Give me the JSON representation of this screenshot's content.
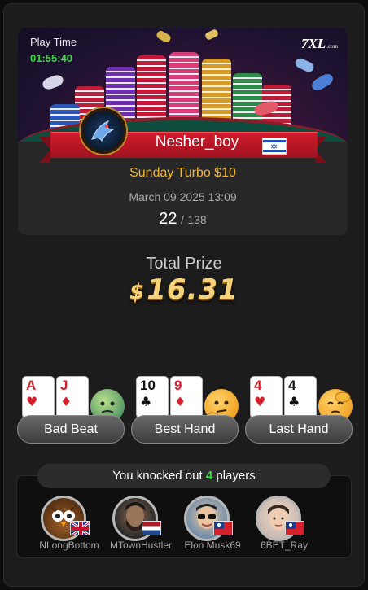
{
  "header": {
    "play_time_label": "Play Time",
    "play_time": "01:55:40",
    "logo_text": "7XL",
    "logo_suffix": ".com"
  },
  "player": {
    "name": "Nesher_boy",
    "flag": "israel-flag"
  },
  "tournament": {
    "name": "Sunday Turbo $10",
    "date": "March 09 2025 13:09",
    "position": "22",
    "separator": "/",
    "total_players": "138"
  },
  "prize": {
    "label": "Total Prize",
    "currency": "$",
    "amount": "16.31"
  },
  "hands": [
    {
      "label": "Bad Beat",
      "cards": [
        {
          "rank": "A",
          "suit": "♥",
          "color": "red"
        },
        {
          "rank": "J",
          "suit": "♦",
          "color": "red"
        }
      ],
      "emoji": "sick-face-icon"
    },
    {
      "label": "Best Hand",
      "cards": [
        {
          "rank": "10",
          "suit": "♣",
          "color": "black"
        },
        {
          "rank": "9",
          "suit": "♦",
          "color": "red"
        }
      ],
      "emoji": "thinking-face-icon"
    },
    {
      "label": "Last Hand",
      "cards": [
        {
          "rank": "4",
          "suit": "♥",
          "color": "red"
        },
        {
          "rank": "4",
          "suit": "♣",
          "color": "black"
        }
      ],
      "emoji": "facepalm-face-icon"
    }
  ],
  "knockouts": {
    "prefix": "You knocked out",
    "count": "4",
    "suffix": "players",
    "players": [
      {
        "name": "NLongBottom",
        "flag": "uk-flag",
        "avatar": "owl-avatar"
      },
      {
        "name": "MTownHustler",
        "flag": "netherlands-flag",
        "avatar": "bearded-man-avatar"
      },
      {
        "name": "Elon Musk69",
        "flag": "taiwan-flag",
        "avatar": "sunglasses-man-avatar"
      },
      {
        "name": "6BET_Ray",
        "flag": "taiwan-flag",
        "avatar": "young-man-avatar"
      }
    ]
  },
  "colors": {
    "accent_green": "#3fd14a",
    "tournament_gold": "#f2b636",
    "ribbon_red": "#d11a2a",
    "prize_gold": "#f6d27a"
  }
}
